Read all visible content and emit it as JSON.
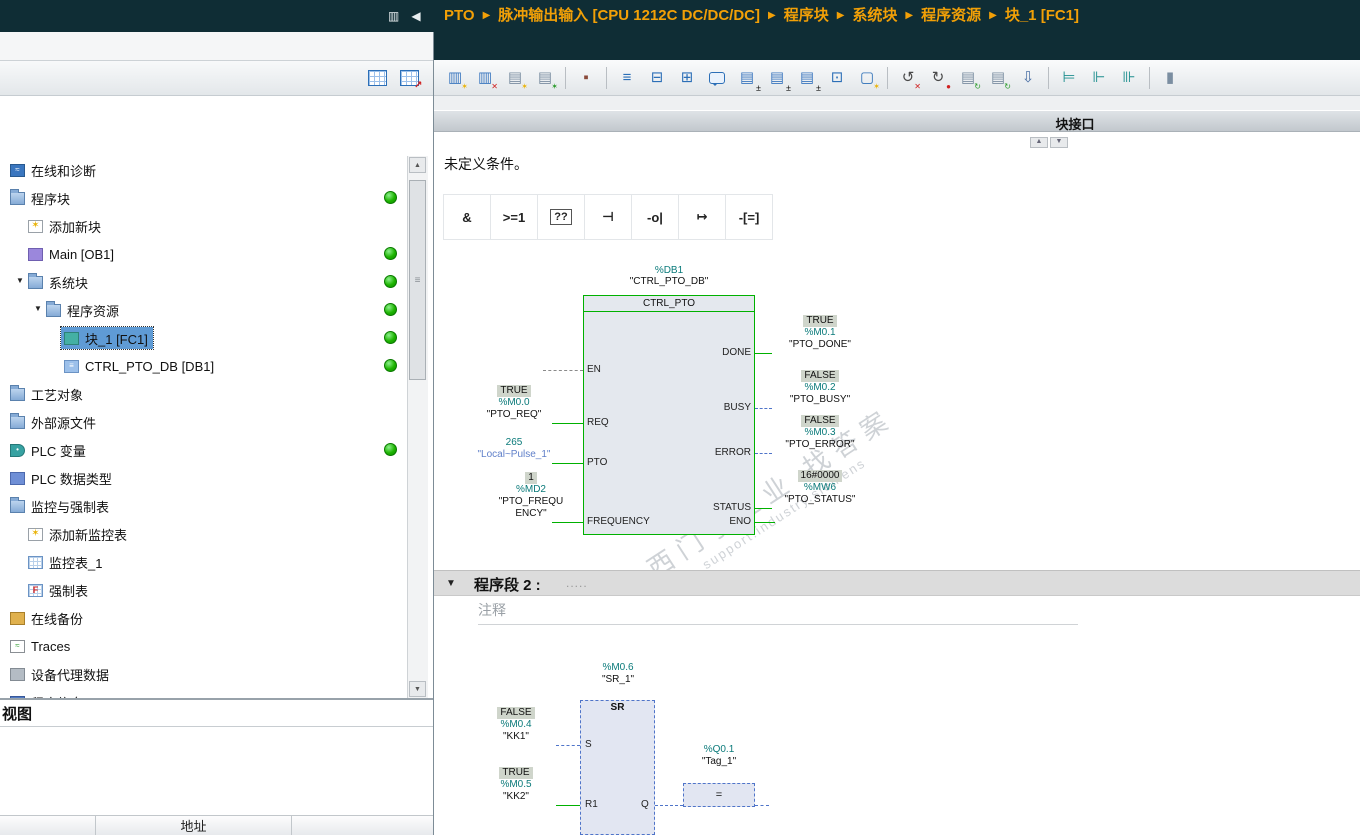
{
  "colors": {
    "titlebar_dark": "#0F2D35",
    "accent_orange": "#F2A007",
    "online_green": "#00B100",
    "signal_false_blue": "#4F74C9",
    "operand_teal": "#0A7A7A",
    "status_dot_green": "#1DB400",
    "selection_blue": "#5F9BD5"
  },
  "titlebar": {
    "panes_icon": "▥",
    "collapse_icon": "◀"
  },
  "breadcrumb": {
    "separator": "▶",
    "segments": [
      "PTO",
      "脉冲输出输入 [CPU 1212C DC/DC/DC]",
      "程序块",
      "系统块",
      "程序资源",
      "块_1 [FC1]"
    ]
  },
  "project_tree": {
    "items": [
      {
        "name": "tree-item-online-diagnostics",
        "label": "在线和诊断",
        "level": 0,
        "icon": "diag"
      },
      {
        "name": "tree-item-program-blocks",
        "label": "程序块",
        "level": 0,
        "icon": "folder",
        "dot": true
      },
      {
        "name": "tree-item-add-new-block",
        "label": "添加新块",
        "level": 1,
        "icon": "addnew"
      },
      {
        "name": "tree-item-main-ob1",
        "label": "Main [OB1]",
        "level": 1,
        "icon": "ob",
        "dot": true
      },
      {
        "name": "tree-item-system-blocks",
        "label": "系统块",
        "level": 1,
        "icon": "folder",
        "dot": true,
        "expanded": true
      },
      {
        "name": "tree-item-program-resources",
        "label": "程序资源",
        "level": 2,
        "icon": "folder",
        "dot": true,
        "expanded": true
      },
      {
        "name": "tree-item-block-1-fc1",
        "label": "块_1 [FC1]",
        "level": 3,
        "icon": "fc",
        "dot": true,
        "selected": true
      },
      {
        "name": "tree-item-ctrl-pto-db-db1",
        "label": "CTRL_PTO_DB [DB1]",
        "level": 3,
        "icon": "db",
        "dot": true
      },
      {
        "name": "tree-item-technology-objects",
        "label": "工艺对象",
        "level": 0,
        "icon": "folder"
      },
      {
        "name": "tree-item-external-source-files",
        "label": "外部源文件",
        "level": 0,
        "icon": "folder"
      },
      {
        "name": "tree-item-plc-tags",
        "label": "PLC 变量",
        "level": 0,
        "icon": "tags",
        "dot": true
      },
      {
        "name": "tree-item-plc-data-types",
        "label": "PLC 数据类型",
        "level": 0,
        "icon": "types"
      },
      {
        "name": "tree-item-watch-force-tables",
        "label": "监控与强制表",
        "level": 0,
        "icon": "folder"
      },
      {
        "name": "tree-item-add-new-watch-table",
        "label": "添加新监控表",
        "level": 1,
        "icon": "addnew"
      },
      {
        "name": "tree-item-watch-table-1",
        "label": "监控表_1",
        "level": 1,
        "icon": "wtable"
      },
      {
        "name": "tree-item-force-table",
        "label": "强制表",
        "level": 1,
        "icon": "ftable"
      },
      {
        "name": "tree-item-online-backups",
        "label": "在线备份",
        "level": 0,
        "icon": "backup"
      },
      {
        "name": "tree-item-traces",
        "label": "Traces",
        "level": 0,
        "icon": "traces"
      },
      {
        "name": "tree-item-device-proxy-data",
        "label": "设备代理数据",
        "level": 0,
        "icon": "proxy"
      },
      {
        "name": "tree-item-program-info",
        "label": "程序信息",
        "level": 0,
        "icon": "info"
      }
    ]
  },
  "editor": {
    "toolbar_icons": [
      {
        "name": "insert-network-icon",
        "glyph": "▥",
        "color": "#3a76bf",
        "badge": "✶",
        "badge_color": "#eab308"
      },
      {
        "name": "delete-network-icon",
        "glyph": "▥",
        "color": "#3a76bf",
        "badge": "✕",
        "badge_color": "#d02020"
      },
      {
        "name": "insert-empty-box-icon",
        "glyph": "▤",
        "color": "#7b8ea1",
        "badge": "✶",
        "badge_color": "#eab308"
      },
      {
        "name": "insert-comment-icon",
        "glyph": "▤",
        "color": "#7b8ea1",
        "badge": "✶",
        "badge_color": "#2a9a2a"
      },
      {
        "sep": true
      },
      {
        "name": "keep-actual-values-icon",
        "glyph": "▪",
        "color": "#8a4a3a"
      },
      {
        "sep": true
      },
      {
        "name": "expand-all-networks-icon",
        "glyph": "≡",
        "color": "#2c6fb7"
      },
      {
        "name": "open-all-networks-icon",
        "glyph": "⊟",
        "color": "#2c6fb7"
      },
      {
        "name": "close-all-networks-icon",
        "glyph": "⊞",
        "color": "#2c6fb7"
      },
      {
        "name": "network-comments-toggle-icon",
        "shape": "bubble"
      },
      {
        "name": "absolute-symbolic-operands-icon",
        "glyph": "▤",
        "color": "#3a76bf",
        "suffix": "±"
      },
      {
        "name": "symbol-information-icon",
        "glyph": "▤",
        "color": "#3a76bf",
        "suffix": "±"
      },
      {
        "name": "operand-display-icon",
        "glyph": "▤",
        "color": "#3a76bf",
        "suffix": "±"
      },
      {
        "name": "block-interface-toggle-icon",
        "glyph": "⊡",
        "color": "#2c6fb7"
      },
      {
        "name": "favorites-toggle-icon",
        "glyph": "▢",
        "color": "#2c6fb7",
        "badge": "✶",
        "badge_color": "#eab308"
      },
      {
        "sep": true
      },
      {
        "name": "go-to-previous-error-icon",
        "glyph": "↺",
        "color": "#4a4a4a",
        "badge": "✕",
        "badge_color": "#d02020"
      },
      {
        "name": "go-to-next-error-icon",
        "glyph": "↻",
        "color": "#4a4a4a",
        "badge": "●",
        "badge_color": "#d02020"
      },
      {
        "name": "update-block-calls-ic",
        "glyph": "▤",
        "color": "#7b8ea1",
        "badge": "↻",
        "badge_color": "#2a9a2a"
      },
      {
        "name": "consistency-check-icon",
        "glyph": "▤",
        "color": "#7b8ea1",
        "badge": "↻",
        "badge_color": "#2a9a2a"
      },
      {
        "name": "download-icon",
        "glyph": "⇩",
        "color": "#4a6fa5"
      },
      {
        "sep": true
      },
      {
        "name": "go-online-icon",
        "glyph": "⊨",
        "color": "#1f8f8f"
      },
      {
        "name": "monitoring-toggle-icon",
        "glyph": "⊩",
        "color": "#1f8f8f"
      },
      {
        "name": "monitoring-snapshot-icon",
        "glyph": "⊪",
        "color": "#1f8f8f"
      },
      {
        "sep": true
      },
      {
        "name": "call-environment-icon",
        "glyph": "▮",
        "color": "#7b8ea1"
      }
    ],
    "interface_bar_label": "块接口",
    "message": "未定义条件。",
    "favorites": [
      {
        "name": "and-box-icon",
        "glyph": "&"
      },
      {
        "name": "or-box-icon",
        "glyph": ">=1"
      },
      {
        "name": "empty-box-icon",
        "glyph": "??",
        "boxed": true
      },
      {
        "name": "insert-input-icon",
        "glyph": "⊣"
      },
      {
        "name": "negate-input-icon",
        "glyph": "-o|"
      },
      {
        "name": "open-branch-icon",
        "glyph": "↦"
      },
      {
        "name": "assignment-icon",
        "glyph": "-[=]"
      }
    ],
    "watermark": {
      "line1": "西门子工业 找答案",
      "line2": "support.industry.siemens"
    },
    "network1": {
      "db_address": "%DB1",
      "db_name": "\"CTRL_PTO_DB\"",
      "title": "CTRL_PTO",
      "pins": {
        "en": "EN",
        "req": "REQ",
        "pto": "PTO",
        "frequency": "FREQUENCY",
        "done": "DONE",
        "busy": "BUSY",
        "error": "ERROR",
        "status": "STATUS",
        "eno": "ENO"
      },
      "req_operand": {
        "value": "TRUE",
        "address": "%M0.0",
        "tag": "\"PTO_REQ\""
      },
      "pto_operand": {
        "value": "265",
        "tag": "\"Local~Pulse_1\""
      },
      "frequency_operand": {
        "value": "1",
        "address": "%MD2",
        "tag": "\"PTO_FREQUENCY\""
      },
      "done_operand": {
        "value": "TRUE",
        "address": "%M0.1",
        "tag": "\"PTO_DONE\""
      },
      "busy_operand": {
        "value": "FALSE",
        "address": "%M0.2",
        "tag": "\"PTO_BUSY\""
      },
      "error_operand": {
        "value": "FALSE",
        "address": "%M0.3",
        "tag": "\"PTO_ERROR\""
      },
      "status_operand": {
        "value": "16#0000",
        "address": "%MW6",
        "tag": "\"PTO_STATUS\""
      }
    },
    "network2": {
      "collapse_icon": "▼",
      "title": "程序段 2 :",
      "title_dots": ".....",
      "comment_placeholder": "注释",
      "sr_operand": {
        "address": "%M0.6",
        "tag": "\"SR_1\""
      },
      "sr_title": "SR",
      "pin_s": "S",
      "pin_r1": "R1",
      "pin_q": "Q",
      "s_operand": {
        "value": "FALSE",
        "address": "%M0.4",
        "tag": "\"KK1\""
      },
      "r1_operand": {
        "value": "TRUE",
        "address": "%M0.5",
        "tag": "\"KK2\""
      },
      "q_operand": {
        "address": "%Q0.1",
        "tag": "\"Tag_1\""
      },
      "coil_symbol": "="
    }
  },
  "detail_view": {
    "title": "视图",
    "address_column": "地址"
  }
}
